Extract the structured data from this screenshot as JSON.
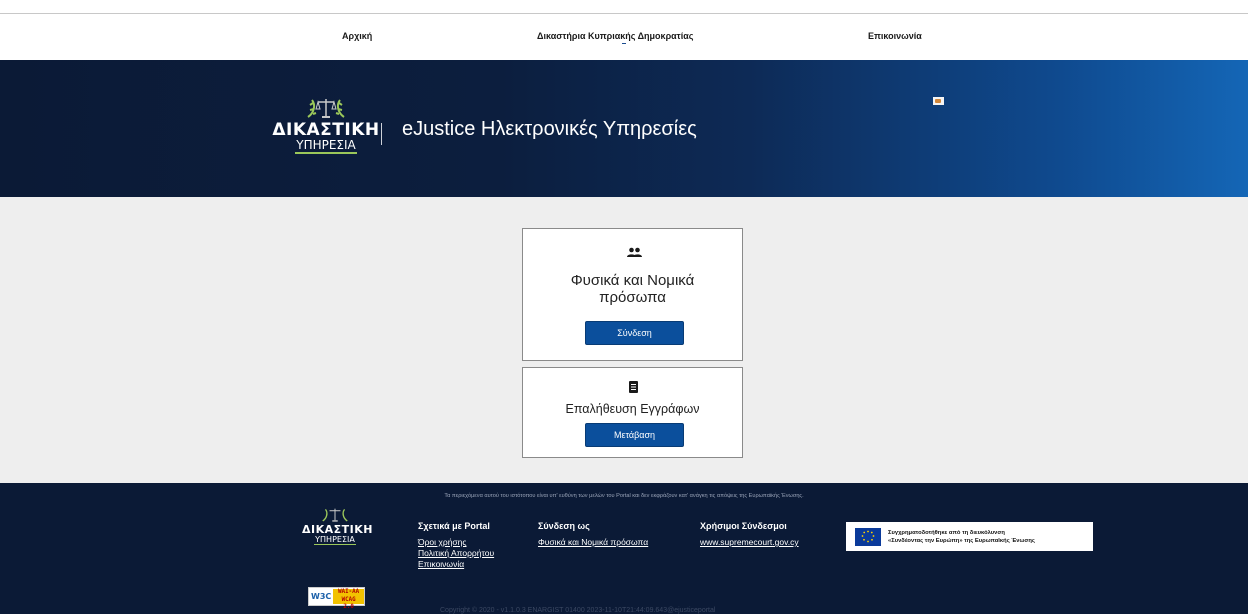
{
  "nav": {
    "home": "Αρχική",
    "courts": "Δικαστήρια Κυπριακής Δημοκρατίας",
    "contact": "Επικοινωνία"
  },
  "hero": {
    "logo_line1": "ΔΙΚΑΣΤΙΚΗ",
    "logo_line2": "ΥΠΗΡΕΣΙΑ",
    "title": "eJustice Ηλεκτρονικές Υπηρεσίες"
  },
  "cards": {
    "persons": {
      "icon": "users-icon",
      "title_line1": "Φυσικά και Νομικά",
      "title_line2": "πρόσωπα",
      "button": "Σύνδεση"
    },
    "verify": {
      "icon": "document-icon",
      "title": "Επαλήθευση Εγγράφων",
      "button": "Μετάβαση"
    }
  },
  "footer": {
    "disclaimer": "Τα περιεχόμενα αυτού του ιστότοπου είναι υπ' ευθύνη των μελών του Portal και δεν εκφράζουν κατ' ανάγκη τις απόψεις της Ευρωπαϊκής Ένωσης.",
    "logo_line1": "ΔΙΚΑΣΤΙΚΗ",
    "logo_line2": "ΥΠΗΡΕΣΙΑ",
    "about": {
      "heading": "Σχετικά με Portal",
      "links": [
        "Όροι χρήσης",
        "Πολιτική Απορρήτου",
        "Επικοινωνία"
      ]
    },
    "login": {
      "heading": "Σύνδεση ως",
      "links": [
        "Φυσικά και Νομικά πρόσωπα"
      ]
    },
    "useful": {
      "heading": "Χρήσιμοι Σύνδεσμοι",
      "links": [
        "www.supremecourt.gov.cy"
      ]
    },
    "eu_line1": "Συγχρηματοδοτήθηκε από τη διευκόλυνση",
    "eu_line2": "«Συνδέοντας την Ευρώπη» της Ευρωπαϊκής Ένωσης",
    "w3c": "W3C",
    "wcag_line1": "WAI-AA",
    "wcag_line2": "WCAG 2.0",
    "copyright": "Copyright © 2020 - v1.1.0.3 ENARGIST 01400 2023-11-10T21:44:09.643@ejusticeportal"
  },
  "colors": {
    "primary_button": "#0b4f9c",
    "hero_dark": "#0b1a36",
    "hero_light": "#1466b6",
    "footer_bg": "#0b1a36",
    "main_bg": "#eeeeee"
  }
}
